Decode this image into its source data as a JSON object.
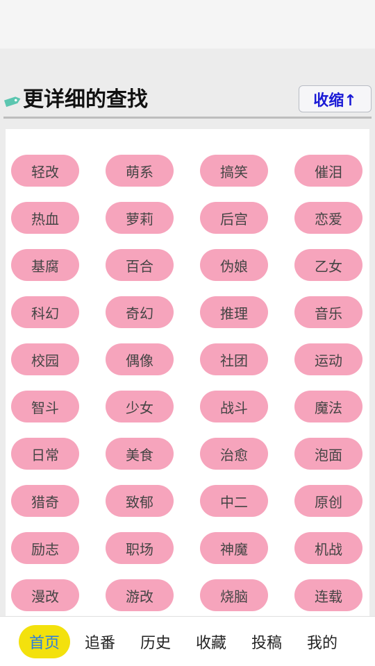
{
  "section": {
    "title": "更详细的查找",
    "collapse_label": "收缩↑",
    "icon": "tag-icon"
  },
  "tags": [
    "轻改",
    "萌系",
    "搞笑",
    "催泪",
    "热血",
    "萝莉",
    "后宫",
    "恋爱",
    "基腐",
    "百合",
    "伪娘",
    "乙女",
    "科幻",
    "奇幻",
    "推理",
    "音乐",
    "校园",
    "偶像",
    "社团",
    "运动",
    "智斗",
    "少女",
    "战斗",
    "魔法",
    "日常",
    "美食",
    "治愈",
    "泡面",
    "猎奇",
    "致郁",
    "中二",
    "原创",
    "励志",
    "职场",
    "神魔",
    "机战",
    "漫改",
    "游改",
    "烧脑",
    "连载"
  ],
  "nav": [
    {
      "label": "首页",
      "active": true
    },
    {
      "label": "追番",
      "active": false
    },
    {
      "label": "历史",
      "active": false
    },
    {
      "label": "收藏",
      "active": false
    },
    {
      "label": "投稿",
      "active": false
    },
    {
      "label": "我的",
      "active": false
    }
  ],
  "colors": {
    "tag_bg": "#f6a4bc",
    "nav_active_bg": "#f3e10d",
    "nav_active_text": "#2b7de0",
    "collapse_text": "#1a1ad6"
  }
}
